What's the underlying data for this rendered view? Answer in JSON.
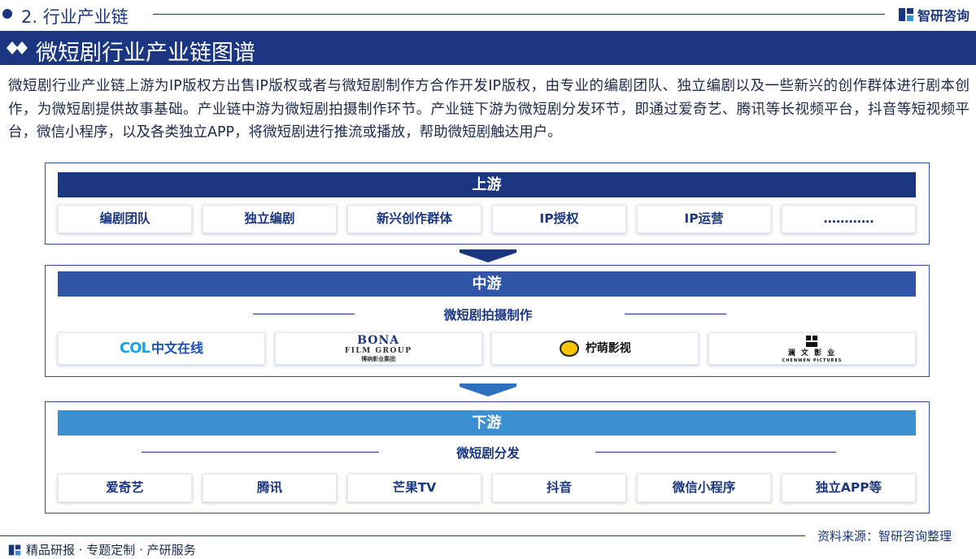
{
  "top": {
    "section_label": "2. 行业产业链",
    "brand_name": "智研咨询"
  },
  "title": "微短剧行业产业链图谱",
  "intro": "微短剧行业产业链上游为IP版权方出售IP版权或者与微短剧制作方合作开发IP版权，由专业的编剧团队、独立编剧以及一些新兴的创作群体进行剧本创作，为微短剧提供故事基础。产业链中游为微短剧拍摄制作环节。产业链下游为微短剧分发环节，即通过爱奇艺、腾讯等长视频平台，抖音等短视频平台，微信小程序，以及各类独立APP，将微短剧进行推流或播放，帮助微短剧触达用户。",
  "upstream": {
    "header": "上游",
    "items": [
      "编剧团队",
      "独立编剧",
      "新兴创作群体",
      "IP授权",
      "IP运营",
      "…………"
    ]
  },
  "midstream": {
    "header": "中游",
    "subtitle": "微短剧拍摄制作",
    "logos": {
      "col": {
        "mark": "COL",
        "name": "中文在线"
      },
      "bona": {
        "line1": "BONA",
        "line2": "FILM GROUP",
        "line3": "博纳影业集团"
      },
      "lemon": {
        "name": "柠萌影视"
      },
      "chenwen": {
        "cn": "澜 文 影 业",
        "en": "CHENWEN PICTURES"
      }
    }
  },
  "downstream": {
    "header": "下游",
    "subtitle": "微短剧分发",
    "items": [
      "爱奇艺",
      "腾讯",
      "芒果TV",
      "抖音",
      "微信小程序",
      "独立APP等"
    ]
  },
  "footer": {
    "source": "资料来源：智研咨询整理",
    "tagline": "精品研报 · 专题定制 · 产研服务"
  },
  "colors": {
    "navy": "#1a3680",
    "upstream_header": "#1a3680",
    "midstream_header": "#2f55a8",
    "downstream_header": "#3a8fd0"
  }
}
